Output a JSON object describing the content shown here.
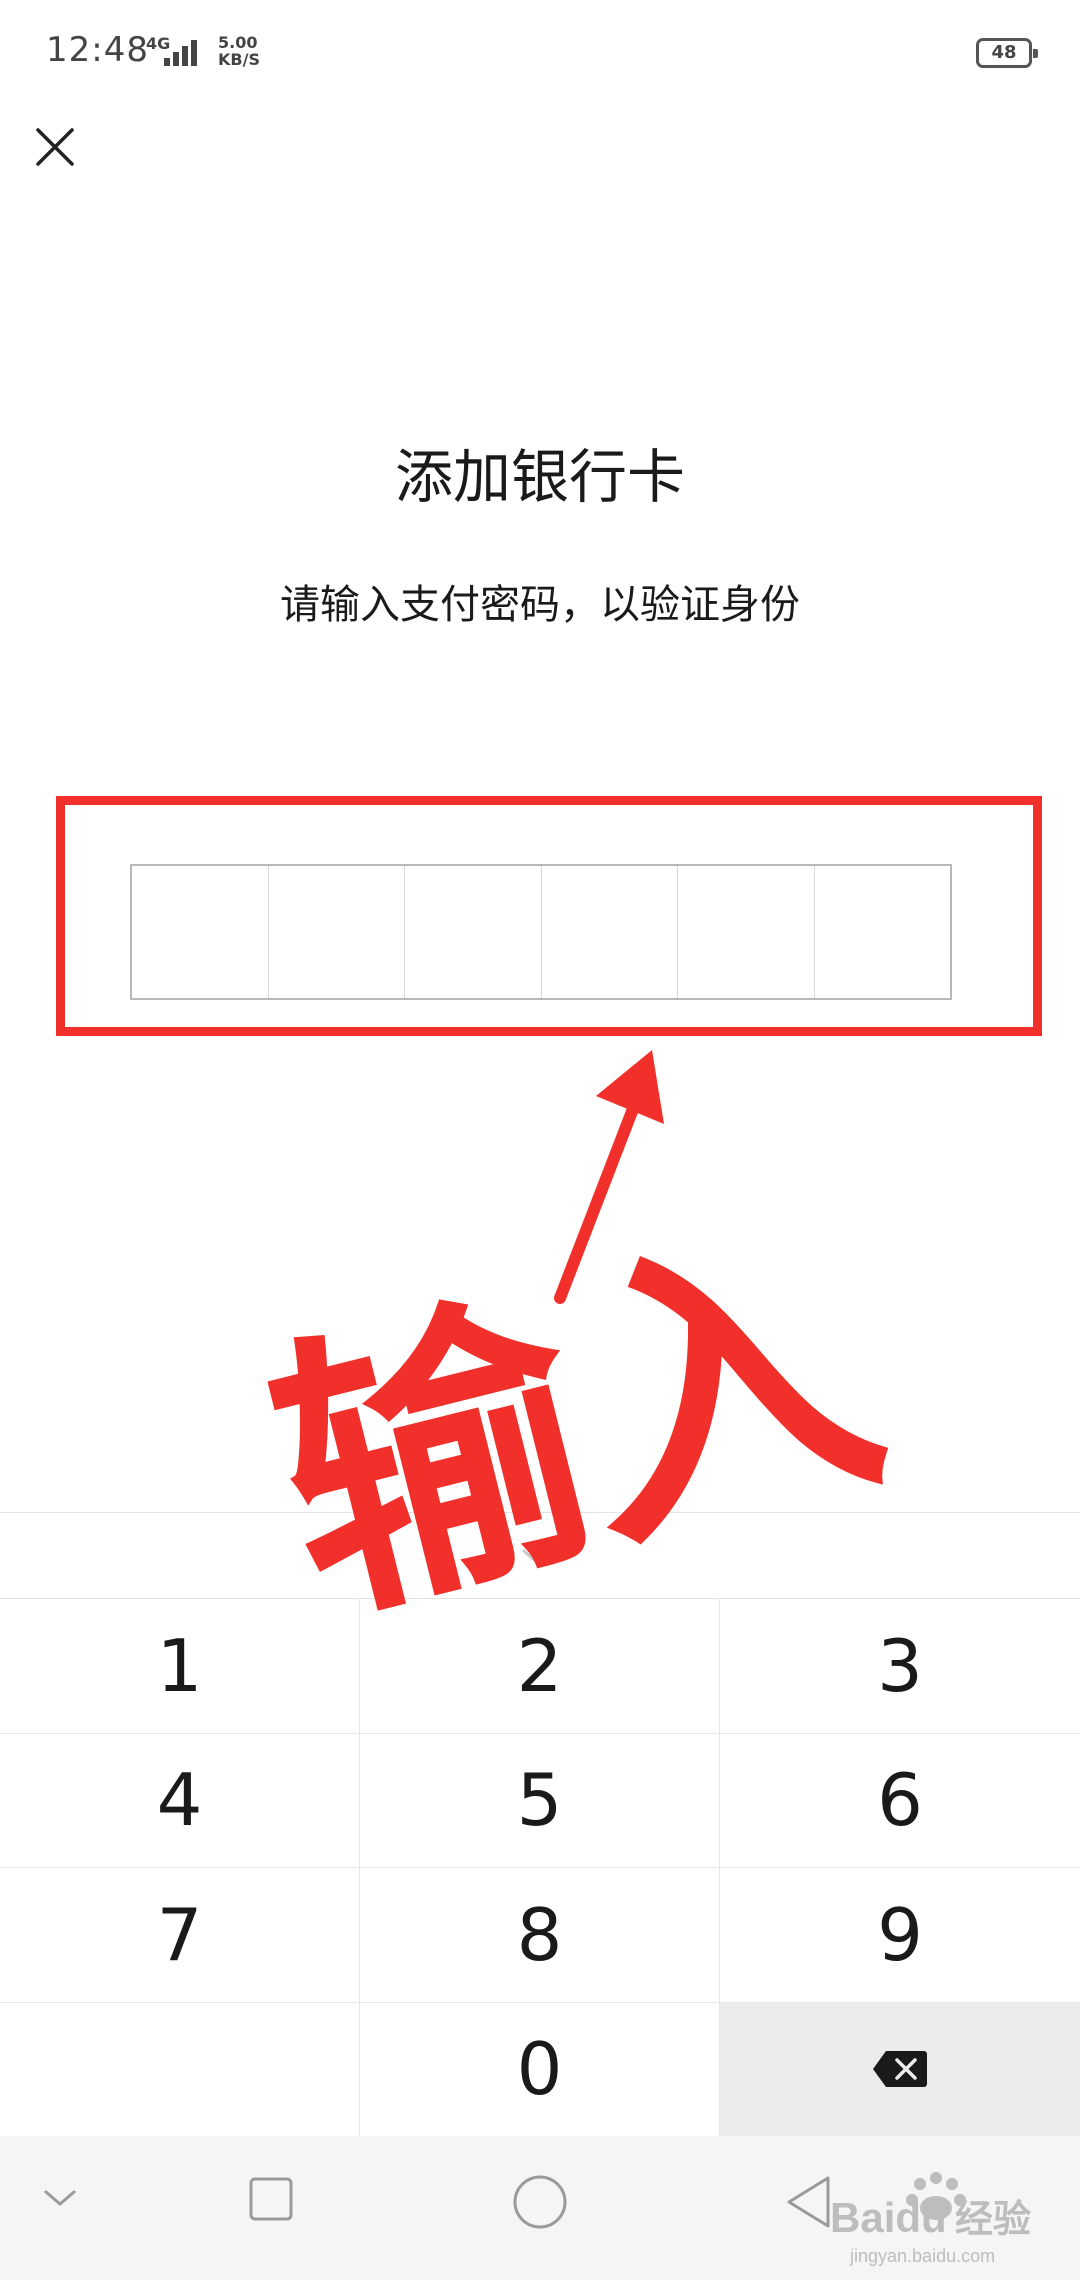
{
  "status_bar": {
    "time": "12:48",
    "network": "4G",
    "speed_value": "5.00",
    "speed_unit": "KB/S",
    "battery": "48"
  },
  "header": {
    "close_icon": "close-icon"
  },
  "content": {
    "title": "添加银行卡",
    "subtitle": "请输入支付密码，以验证身份"
  },
  "pin": {
    "length": 6
  },
  "annotation": {
    "text": "输入",
    "color": "#f2302b"
  },
  "keypad": {
    "keys": [
      "1",
      "2",
      "3",
      "4",
      "5",
      "6",
      "7",
      "8",
      "9",
      "",
      "0",
      "⌫"
    ],
    "delete_icon": "backspace-icon",
    "collapse_icon": "chevron-down-icon"
  },
  "navbar": {
    "items": [
      "hide-keyboard-icon",
      "recent-apps-icon",
      "home-icon",
      "back-icon"
    ]
  },
  "watermark": {
    "brand": "Baidu",
    "brand_cn": "经验",
    "url": "jingyan.baidu.com"
  }
}
